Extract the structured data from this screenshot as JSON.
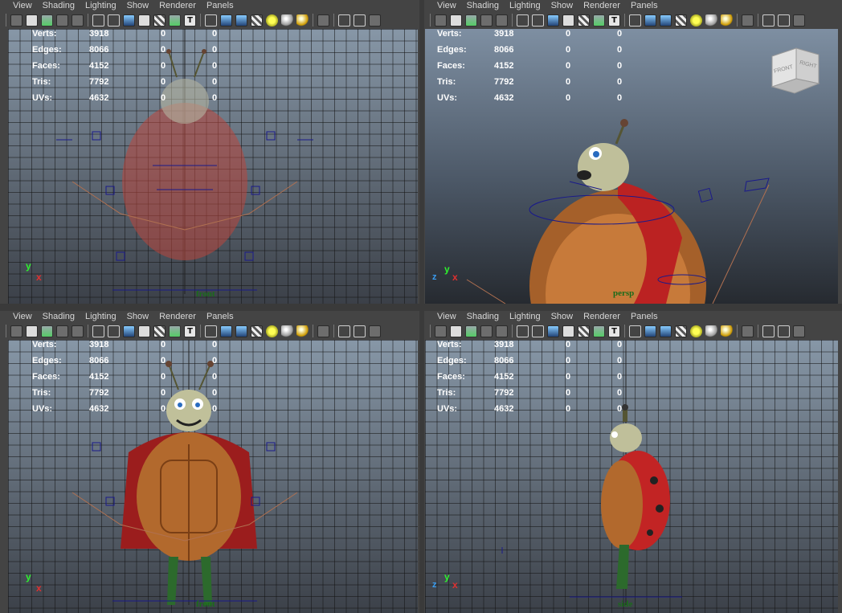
{
  "menu": [
    "View",
    "Shading",
    "Lighting",
    "Show",
    "Renderer",
    "Panels"
  ],
  "stats": [
    {
      "label": "Verts:",
      "v1": "3918",
      "v2": "0",
      "v3": "0"
    },
    {
      "label": "Edges:",
      "v1": "8066",
      "v2": "0",
      "v3": "0"
    },
    {
      "label": "Faces:",
      "v1": "4152",
      "v2": "0",
      "v3": "0"
    },
    {
      "label": "Tris:",
      "v1": "7792",
      "v2": "0",
      "v3": "0"
    },
    {
      "label": "UVs:",
      "v1": "4632",
      "v2": "0",
      "v3": "0"
    }
  ],
  "axis": {
    "y": "y",
    "x": "x",
    "z": "z"
  },
  "viewcube": {
    "front": "FRONT",
    "right": "RIGHT"
  },
  "panes": {
    "top_left": {
      "camera": "front"
    },
    "top_right": {
      "camera": "persp"
    },
    "bottom_left": {
      "camera": "front"
    },
    "bottom_right": {
      "camera": "side"
    }
  },
  "colors": {
    "stats_text": "#ffffff",
    "camera_label": "#1a6b1a",
    "axis_x": "#e03030",
    "axis_y": "#2ef22e",
    "axis_z": "#3a9cf0"
  }
}
